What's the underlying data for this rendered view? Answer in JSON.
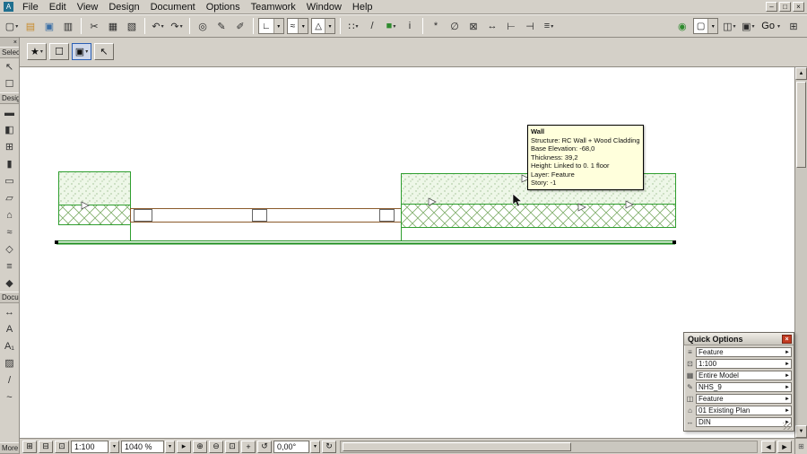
{
  "colors": {
    "chrome": "#d4d0c8",
    "wall_green": "#2f9e2f",
    "hatch_green": "#7fae6a",
    "beam_brown": "#8b5a2b",
    "tooltip_bg": "#ffffdc",
    "selection_blue": "#2a5fb4",
    "close_red": "#c23b22"
  },
  "ui": {
    "dropdown_arrow": "▾",
    "row_arrow": "►",
    "up": "▲",
    "down": "▼",
    "left": "◄",
    "right": "►",
    "close": "×",
    "minimize": "–",
    "restore": "□"
  },
  "menubar": {
    "app_icon_label": "A",
    "items": [
      "File",
      "Edit",
      "View",
      "Design",
      "Document",
      "Options",
      "Teamwork",
      "Window",
      "Help"
    ]
  },
  "toolbar": {
    "go_label": "Go",
    "items": [
      {
        "name": "new-document",
        "glyph": "▢"
      },
      {
        "name": "open-folder",
        "glyph": "▤"
      },
      {
        "name": "save",
        "glyph": "▣"
      },
      {
        "name": "print",
        "glyph": "▥"
      },
      {
        "name": "cut",
        "glyph": "✂"
      },
      {
        "name": "copy",
        "glyph": "▦"
      },
      {
        "name": "paste",
        "glyph": "▧"
      },
      {
        "name": "undo",
        "glyph": "↶"
      },
      {
        "name": "redo",
        "glyph": "↷"
      },
      {
        "name": "find-select",
        "glyph": "◎"
      },
      {
        "name": "pickup-parameters",
        "glyph": "✎"
      },
      {
        "name": "inject-parameters",
        "glyph": "✐"
      },
      {
        "name": "snap-options-combo",
        "glyph": "∟"
      },
      {
        "name": "guide-lines-combo",
        "glyph": "≈"
      },
      {
        "name": "construction-combo",
        "glyph": "△"
      },
      {
        "name": "snap-grid",
        "glyph": "∷"
      },
      {
        "name": "slash-guide",
        "glyph": "/"
      },
      {
        "name": "layers-cube",
        "glyph": "■"
      },
      {
        "name": "info-cursor",
        "glyph": "i"
      },
      {
        "name": "magic-wand",
        "glyph": "*"
      },
      {
        "name": "suspend-groups",
        "glyph": "∅"
      },
      {
        "name": "explode",
        "glyph": "⊠"
      },
      {
        "name": "measure",
        "glyph": "↔"
      },
      {
        "name": "dimension",
        "glyph": "⊢"
      },
      {
        "name": "trim",
        "glyph": "⊣"
      },
      {
        "name": "align",
        "glyph": "≡"
      },
      {
        "name": "compass",
        "glyph": "◉"
      },
      {
        "name": "view-combo",
        "glyph": "▢"
      },
      {
        "name": "layout-book",
        "glyph": "◫"
      },
      {
        "name": "camera",
        "glyph": "▣"
      },
      {
        "name": "organizer-grid",
        "glyph": "⊞"
      }
    ]
  },
  "mini_toolbar": {
    "items": [
      {
        "name": "favorites",
        "glyph": "★"
      },
      {
        "name": "marquee",
        "glyph": "☐"
      },
      {
        "name": "element-settings",
        "glyph": "▣"
      },
      {
        "name": "arrow-tool",
        "glyph": "↖"
      }
    ]
  },
  "sidebar": {
    "sections": {
      "select": "Selec",
      "design": "Desig",
      "document": "Docu",
      "more": "More"
    },
    "select_tools": [
      {
        "name": "arrow-tool",
        "glyph": "↖"
      },
      {
        "name": "marquee-tool",
        "glyph": "☐"
      }
    ],
    "design_tools": [
      {
        "name": "wall-tool",
        "glyph": "▬"
      },
      {
        "name": "door-tool",
        "glyph": "◧"
      },
      {
        "name": "window-tool",
        "glyph": "⊞"
      },
      {
        "name": "column-tool",
        "glyph": "▮"
      },
      {
        "name": "beam-tool",
        "glyph": "▭"
      },
      {
        "name": "slab-tool",
        "glyph": "▱"
      },
      {
        "name": "roof-tool",
        "glyph": "⌂"
      },
      {
        "name": "mesh-tool",
        "glyph": "≈"
      },
      {
        "name": "zone-tool",
        "glyph": "◇"
      },
      {
        "name": "stair-tool",
        "glyph": "≡"
      },
      {
        "name": "object-tool",
        "glyph": "◆"
      }
    ],
    "document_tools": [
      {
        "name": "dimension-tool",
        "glyph": "↔"
      },
      {
        "name": "text-tool",
        "glyph": "A"
      },
      {
        "name": "label-tool",
        "glyph": "A₁"
      },
      {
        "name": "fill-tool",
        "glyph": "▨"
      },
      {
        "name": "line-tool",
        "glyph": "/"
      },
      {
        "name": "spline-tool",
        "glyph": "~"
      }
    ]
  },
  "tooltip": {
    "title": "Wall",
    "lines": [
      "Structure: RC Wall + Wood Cladding",
      "Base Elevation: -68,0",
      "Thickness: 39,2",
      "Height: Linked to 0. 1 floor",
      "Layer: Feature",
      "Story: -1"
    ]
  },
  "quick_options": {
    "title": "Quick Options",
    "rows": [
      {
        "name": "layer-combination",
        "glyph": "≡",
        "value": "Feature"
      },
      {
        "name": "scale",
        "glyph": "⊡",
        "value": "1:100"
      },
      {
        "name": "structure-display",
        "glyph": "▦",
        "value": "Entire Model"
      },
      {
        "name": "pen-set",
        "glyph": "✎",
        "value": "NHS_9"
      },
      {
        "name": "model-view-options",
        "glyph": "◫",
        "value": "Feature"
      },
      {
        "name": "renovation-filter",
        "glyph": "⌂",
        "value": "01 Existing Plan"
      },
      {
        "name": "dimension-standard",
        "glyph": "↔",
        "value": "DIN"
      }
    ]
  },
  "status_bar": {
    "left_icons": [
      {
        "name": "pages",
        "glyph": "⊞"
      },
      {
        "name": "snap",
        "glyph": "⊟"
      },
      {
        "name": "tracker",
        "glyph": "⊡"
      }
    ],
    "scale": "1:100",
    "zoom": "1040 %",
    "view_icons": [
      {
        "name": "play",
        "glyph": "▸"
      },
      {
        "name": "zoom-in",
        "glyph": "⊕"
      },
      {
        "name": "zoom-out",
        "glyph": "⊖"
      },
      {
        "name": "fit-in-window",
        "glyph": "⊡"
      },
      {
        "name": "pan",
        "glyph": "+"
      },
      {
        "name": "rotate-left",
        "glyph": "↺"
      },
      {
        "name": "rotate-right",
        "glyph": "↻"
      }
    ],
    "angle": "0,00°",
    "corner_glyph": "⊞"
  }
}
